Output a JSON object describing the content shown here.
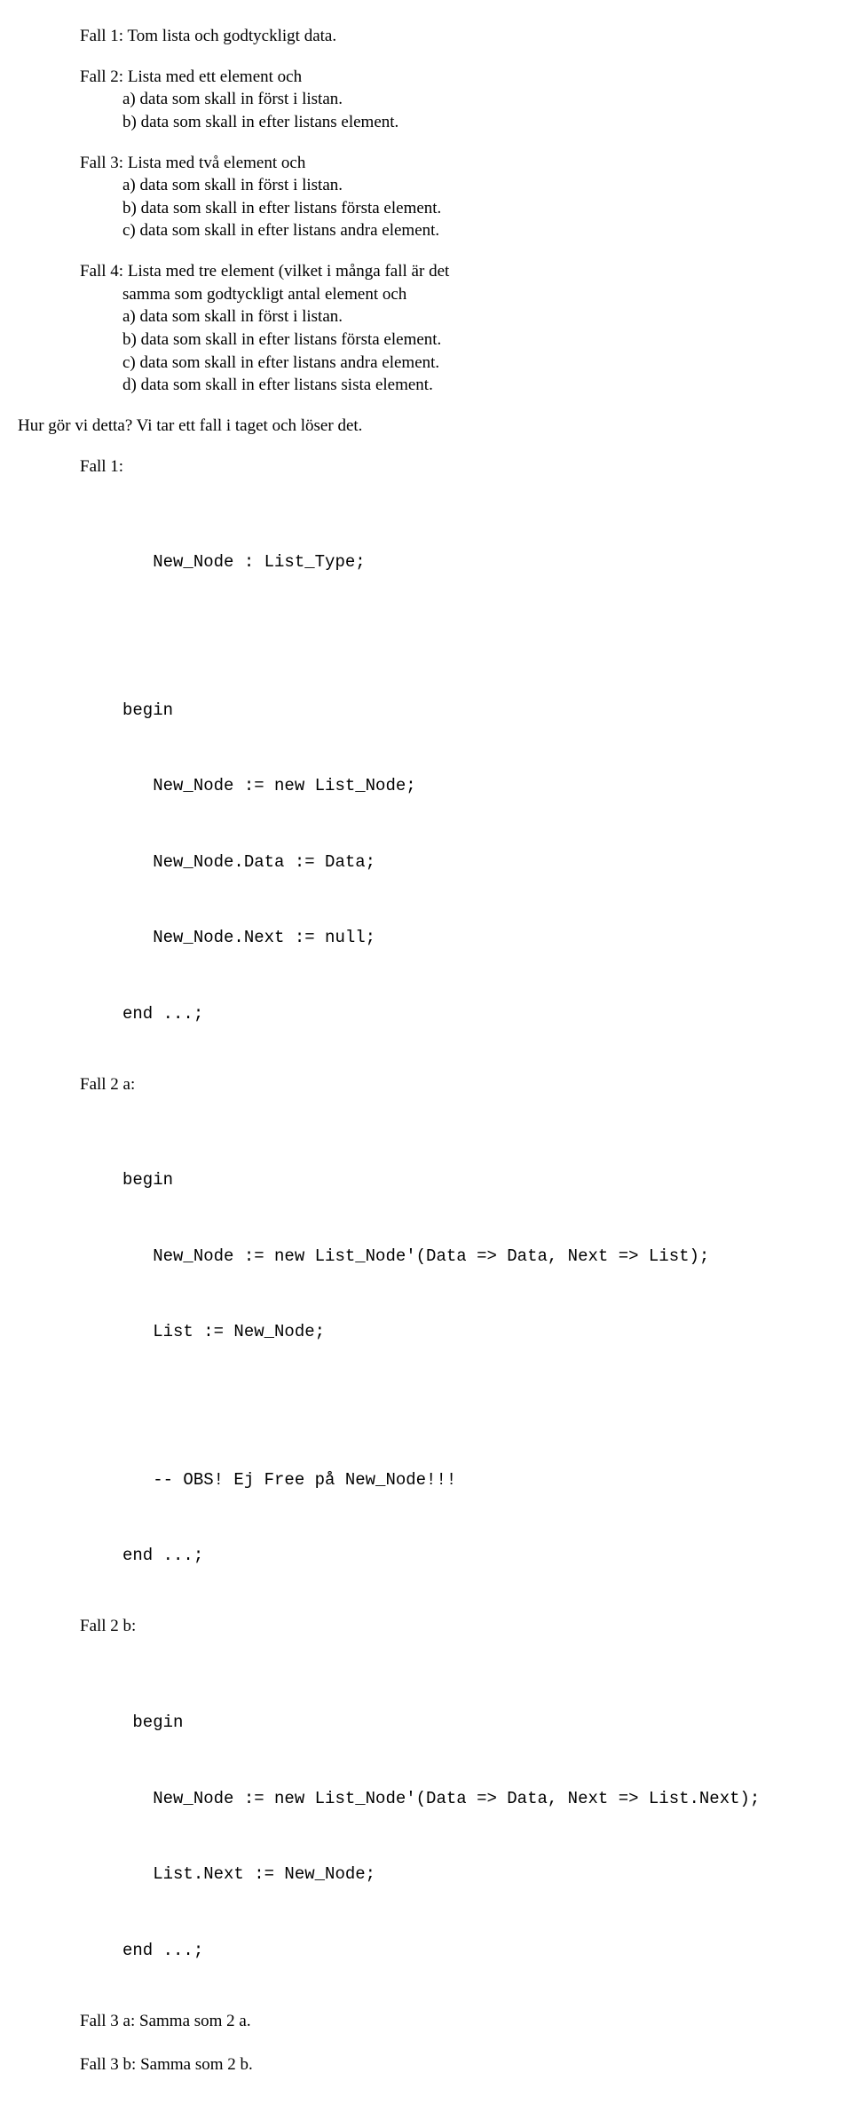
{
  "case1": {
    "title": "Fall 1: Tom lista och godtyckligt data."
  },
  "case2": {
    "title": "Fall 2: Lista med ett element och",
    "a": "a) data som skall in först i listan.",
    "b": "b) data som skall in efter listans element."
  },
  "case3": {
    "title": "Fall 3: Lista med två element och",
    "a": "a) data som skall in först i listan.",
    "b": "b) data som skall in efter listans första element.",
    "c": "c) data som skall in efter listans andra element."
  },
  "case4": {
    "title": "Fall 4: Lista med tre element (vilket i många fall är det",
    "title2": "samma som godtyckligt antal element och",
    "a": "a) data som skall in först i listan.",
    "b": "b) data som skall in efter listans första element.",
    "c": "c) data som skall in efter listans andra element.",
    "d": "d) data som skall in efter listans sista element."
  },
  "q1": "Hur gör vi detta? Vi tar ett fall i taget och löser det.",
  "fall1": {
    "label": "Fall 1:",
    "decl": "   New_Node : List_Type;",
    "begin": "begin",
    "l1": "   New_Node := new List_Node;",
    "l2": "   New_Node.Data := Data;",
    "l3": "   New_Node.Next := null;",
    "end": "end ...;"
  },
  "fall2a": {
    "label": "Fall 2 a:",
    "begin": "begin",
    "l1": "   New_Node := new List_Node'(Data => Data, Next => List);",
    "l2": "   List := New_Node;",
    "comment": "   -- OBS! Ej Free på New_Node!!!",
    "end": "end ...;"
  },
  "fall2b": {
    "label": "Fall 2 b:",
    "begin": " begin",
    "l1": "   New_Node := new List_Node'(Data => Data, Next => List.Next);",
    "l2": "   List.Next := New_Node;",
    "end": "end ...;"
  },
  "fall3a": "Fall 3 a: Samma som 2 a.",
  "fall3b": "Fall 3 b: Samma som 2 b."
}
